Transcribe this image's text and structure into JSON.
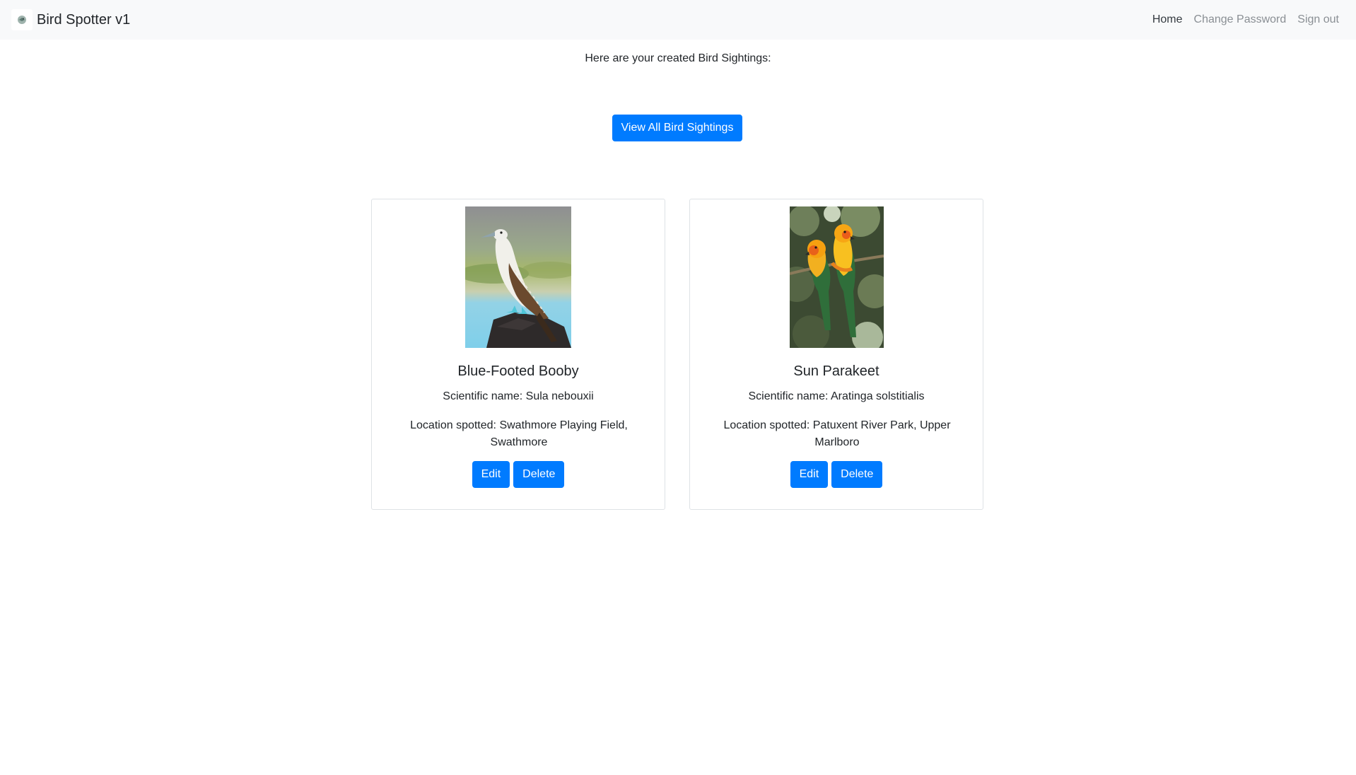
{
  "navbar": {
    "brand": "Bird Spotter v1",
    "logo_icon": "bird-logo-icon",
    "links": [
      {
        "label": "Home",
        "active": true
      },
      {
        "label": "Change Password",
        "active": false
      },
      {
        "label": "Sign out",
        "active": false
      }
    ]
  },
  "main": {
    "intro": "Here are your created Bird Sightings:",
    "view_all_label": "View All Bird Sightings"
  },
  "sightings": [
    {
      "name": "Blue-Footed Booby",
      "scientific": "Scientific name: Sula nebouxii",
      "location": "Location spotted: Swathmore Playing Field, Swathmore",
      "edit_label": "Edit",
      "delete_label": "Delete"
    },
    {
      "name": "Sun Parakeet",
      "scientific": "Scientific name: Aratinga solstitialis",
      "location": "Location spotted: Patuxent River Park, Upper Marlboro",
      "edit_label": "Edit",
      "delete_label": "Delete"
    }
  ],
  "colors": {
    "primary": "#007bff",
    "navbar_bg": "#f8f9fa",
    "nav_inactive": "#8a8f94",
    "card_border": "#dee2e6"
  }
}
